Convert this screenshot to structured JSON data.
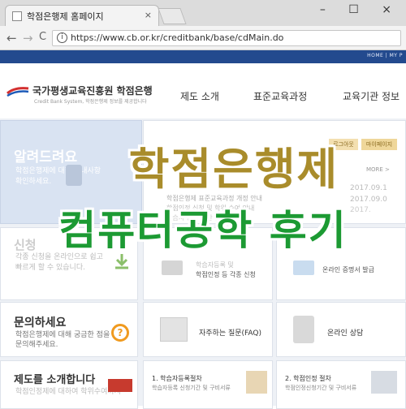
{
  "browser": {
    "tab_title": "학점은행제 홈페이지",
    "tab_close": "×",
    "window_controls": "– ☐ ×",
    "back": "←",
    "forward": "→",
    "reload": "C",
    "url": "https://www.cb.or.kr/creditbank/base/cdMain.do"
  },
  "site": {
    "top_links": "HOME | MY P",
    "logo_text": "국가평생교육진흥원 학점은행",
    "logo_sub": "Credit Bank System, 학점은행제 정보를 제공합니다",
    "nav": [
      "제도 소개",
      "표준교육과정",
      "교육기관 정보"
    ],
    "notice": {
      "title": "알려드려요",
      "desc1": "학점은행제에 대한 안내사항",
      "desc2": "확인하세요.",
      "btn_login": "로그아웃",
      "btn_mypage": "마이페이지",
      "more": "MORE >",
      "items": [
        {
          "text": "학점은행제 표준교육과정 개정 안내",
          "date": "2017.09.1"
        },
        {
          "text": "학점인정 신청 및 학위 수여 안내",
          "date": "2017.09.0"
        },
        {
          "text": "학습자 등록 기간 안내",
          "date": "2017."
        }
      ]
    },
    "apply": {
      "title": "신청",
      "desc1": "각종 신청을 온라인으로 쉽고",
      "desc2": "빠르게 할 수 있습니다.",
      "card1a": "학습자등록 및",
      "card1b": "학점인정 등 각종 신청",
      "card2": "온라인 증명서 발급"
    },
    "inquiry": {
      "title": "문의하세요",
      "desc1": "학점은행제에 대해 궁금한 점을",
      "desc2": "문의해주세요.",
      "faq": "자주하는 질문(FAQ)",
      "online": "온라인 상담"
    },
    "intro": {
      "title": "제도를 소개합니다",
      "desc": "학점인정제에 대하여 학위수여까지",
      "step1": "1. 학습자등록절차",
      "step1_sub": "학습자등록 신청기간 및 구비서류",
      "step2": "2. 학점인정 절차",
      "step2_sub": "학점인정신청기간 및 구비서류"
    }
  },
  "overlay": {
    "line1": "학점은행제",
    "line2": "컴퓨터공학 후기",
    "color1": "#a98c2b",
    "color2": "#1c9a33"
  }
}
